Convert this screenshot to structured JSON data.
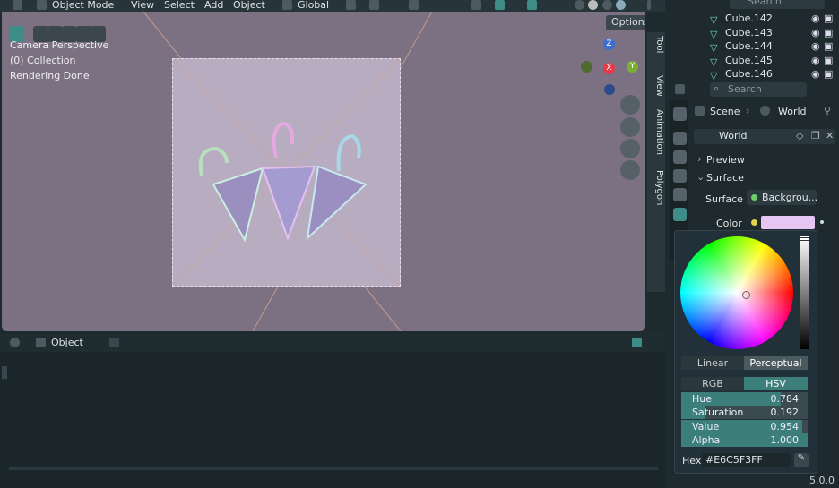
{
  "header": {
    "mode": "Object Mode",
    "menu": [
      "View",
      "Select",
      "Add",
      "Object"
    ],
    "orientation": "Global"
  },
  "viewport": {
    "overlay": [
      "Camera Perspective",
      "(0) Collection",
      "Rendering Done"
    ],
    "options_label": "Options",
    "side_tabs": [
      "Tool",
      "View",
      "Animation",
      "Polygon"
    ],
    "axes": {
      "z": "Z",
      "x": "X",
      "y": "Y"
    },
    "bg_color": "#7C7183"
  },
  "timeline": {
    "mode_label": "Object"
  },
  "outliner": {
    "search_placeholder": "Search",
    "items": [
      "Cube.142",
      "Cube.143",
      "Cube.144",
      "Cube.145",
      "Cube.146"
    ]
  },
  "properties": {
    "search_placeholder": "Search",
    "breadcrumb_scene": "Scene",
    "breadcrumb_world": "World",
    "world_name": "World",
    "preview_label": "Preview",
    "surface_label": "Surface",
    "surface_field_label": "Surface",
    "surface_value": "Backgrou...",
    "color_label": "Color",
    "color_swatch": "#E6C5F3"
  },
  "picker": {
    "modes_a": [
      "Linear",
      "Perceptual"
    ],
    "modes_b": [
      "RGB",
      "HSV"
    ],
    "sliders": [
      {
        "label": "Hue",
        "value": "0.784",
        "fraction": 0.784
      },
      {
        "label": "Saturation",
        "value": "0.192",
        "fraction": 0.192
      },
      {
        "label": "Value",
        "value": "0.954",
        "fraction": 0.954
      },
      {
        "label": "Alpha",
        "value": "1.000",
        "fraction": 1.0
      }
    ],
    "hex_label": "Hex",
    "hex_value": "#E6C5F3FF"
  },
  "status": {
    "version": "5.0.0"
  }
}
